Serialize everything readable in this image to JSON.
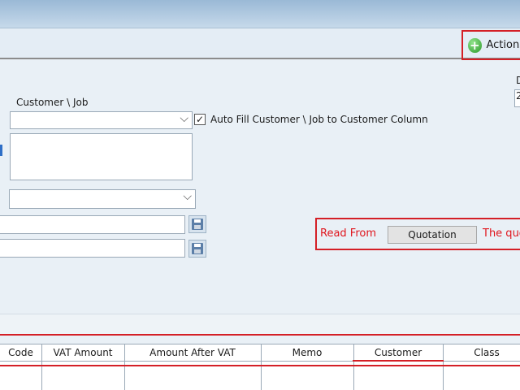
{
  "toolbar": {
    "actions_label": "Actions"
  },
  "form": {
    "customer_job_label": "Customer \\ Job",
    "customer_job_value": "",
    "autofill_checked": true,
    "autofill_label": "Auto Fill Customer \\ Job to Customer Column",
    "date_label_fragment": "D",
    "date_value_fragment": "2"
  },
  "read_from": {
    "label": "Read From",
    "quotation_button": "Quotation",
    "trailing_text": "The quo"
  },
  "grid": {
    "columns": [
      "Code",
      "VAT Amount",
      "Amount After VAT",
      "Memo",
      "Customer",
      "Class"
    ]
  },
  "colors": {
    "highlight": "#d41f26",
    "accent_red_text": "#e0151d"
  }
}
